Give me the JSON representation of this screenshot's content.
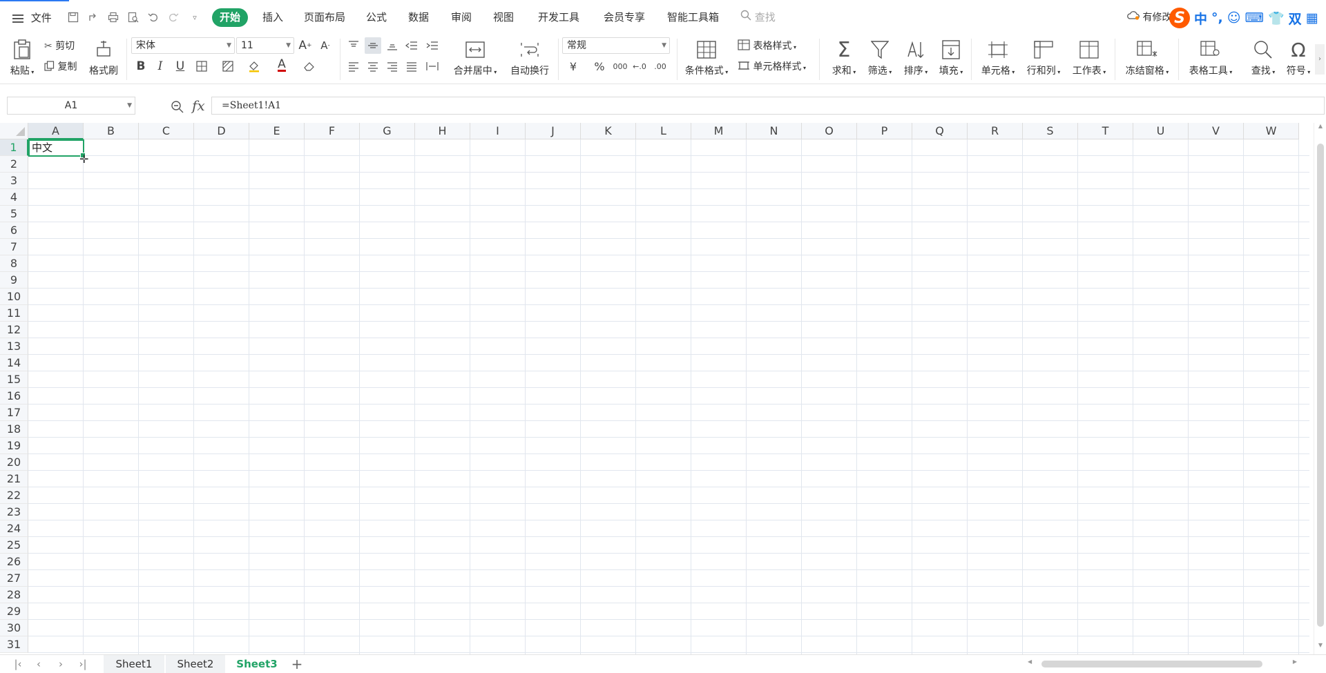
{
  "menubar": {
    "file_label": "文件",
    "tabs": [
      "开始",
      "插入",
      "页面布局",
      "公式",
      "数据",
      "审阅",
      "视图",
      "开发工具",
      "会员专享",
      "智能工具箱"
    ],
    "search_placeholder": "查找",
    "cloud_status": "有修改",
    "ime": {
      "mode_label": "中",
      "punct_label": "°,",
      "double_label": "双"
    }
  },
  "ribbon": {
    "paste": "粘贴",
    "cut": "剪切",
    "copy": "复制",
    "format_painter": "格式刷",
    "font_name": "宋体",
    "font_size": "11",
    "merge_center": "合并居中",
    "wrap_text": "自动换行",
    "number_format": "常规",
    "cond_format": "条件格式",
    "table_style": "表格样式",
    "cell_style": "单元格样式",
    "sum": "求和",
    "filter": "筛选",
    "sort": "排序",
    "fill": "填充",
    "cell": "单元格",
    "row_col": "行和列",
    "worksheet": "工作表",
    "freeze": "冻结窗格",
    "table_tools": "表格工具",
    "find": "查找",
    "symbol": "符号",
    "currency_symbol": "¥",
    "percent_symbol": "%",
    "thousands_symbol": "000",
    "bold": "B",
    "italic": "I",
    "underline": "U",
    "font_color_letter": "A"
  },
  "formula_bar": {
    "name_box": "A1",
    "fx_label": "fx",
    "formula": "=Sheet1!A1"
  },
  "sheet": {
    "columns": [
      "A",
      "B",
      "C",
      "D",
      "E",
      "F",
      "G",
      "H",
      "I",
      "J",
      "K",
      "L",
      "M",
      "N",
      "O",
      "P",
      "Q",
      "R",
      "S",
      "T",
      "U",
      "V",
      "W"
    ],
    "rows": [
      "1",
      "2",
      "3",
      "4",
      "5",
      "6",
      "7",
      "8",
      "9",
      "10",
      "11",
      "12",
      "13",
      "14",
      "15",
      "16",
      "17",
      "18",
      "19",
      "20",
      "21",
      "22",
      "23",
      "24",
      "25",
      "26",
      "27",
      "28",
      "29",
      "30",
      "31"
    ],
    "selected_cell_value": "中文"
  },
  "sheet_tabs": [
    "Sheet1",
    "Sheet2",
    "Sheet3"
  ],
  "active_sheet": "Sheet3",
  "colors": {
    "accent": "#21a366",
    "ime_logo": "#ff5a00"
  }
}
